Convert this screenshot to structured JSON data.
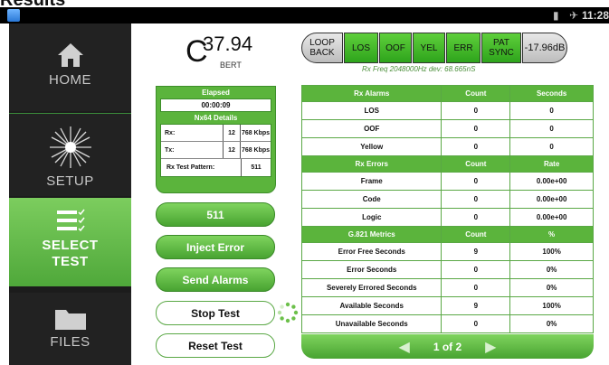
{
  "window": {
    "title": "Results",
    "time": "11:28"
  },
  "colors": {
    "accent_green": "#5bb43c",
    "alarm_green": "#2ea41c",
    "sidebar_bg": "#1c1c1c"
  },
  "nav": {
    "home": {
      "label": "HOME",
      "icon": "home-icon"
    },
    "setup": {
      "label": "SETUP",
      "icon": "starburst-icon"
    },
    "select_test": {
      "label_line1": "SELECT",
      "label_line2": "TEST",
      "icon": "checklist-icon"
    },
    "files": {
      "label": "FILES",
      "icon": "folder-icon"
    }
  },
  "bert": {
    "value": "37.94",
    "label": "BERT"
  },
  "alarms": {
    "loop_back_line1": "LOOP",
    "loop_back_line2": "BACK",
    "items": [
      "LOS",
      "OOF",
      "YEL",
      "ERR",
      "PAT SYNC"
    ],
    "level": "-17.96dB",
    "rx_freq": "Rx Freq 2048000Hz dev: 68.665nS"
  },
  "elapsed": {
    "header": "Elapsed",
    "time": "00:00:09",
    "nx64_header": "Nx64 Details",
    "rx_label": "Rx:",
    "rx_slots": "12",
    "rx_rate": "768 Kbps",
    "tx_label": "Tx:",
    "tx_slots": "12",
    "tx_rate": "768 Kbps",
    "pattern_label": "Rx Test Pattern:",
    "pattern_value": "511"
  },
  "buttons": {
    "pattern": "511",
    "inject_error": "Inject Error",
    "send_alarms": "Send Alarms",
    "stop_test": "Stop Test",
    "reset_test": "Reset Test"
  },
  "table": {
    "sections": [
      {
        "header": [
          "Rx Alarms",
          "Count",
          "Seconds"
        ],
        "rows": [
          [
            "LOS",
            "0",
            "0"
          ],
          [
            "OOF",
            "0",
            "0"
          ],
          [
            "Yellow",
            "0",
            "0"
          ]
        ]
      },
      {
        "header": [
          "Rx Errors",
          "Count",
          "Rate"
        ],
        "rows": [
          [
            "Frame",
            "0",
            "0.00e+00"
          ],
          [
            "Code",
            "0",
            "0.00e+00"
          ],
          [
            "Logic",
            "0",
            "0.00e+00"
          ]
        ]
      },
      {
        "header": [
          "G.821 Metrics",
          "Count",
          "%"
        ],
        "rows": [
          [
            "Error Free Seconds",
            "9",
            "100%"
          ],
          [
            "Error Seconds",
            "0",
            "0%"
          ],
          [
            "Severely Errored Seconds",
            "0",
            "0%"
          ],
          [
            "Available Seconds",
            "9",
            "100%"
          ],
          [
            "Unavailable Seconds",
            "0",
            "0%"
          ]
        ]
      }
    ]
  },
  "pager": {
    "text": "1 of 2"
  }
}
